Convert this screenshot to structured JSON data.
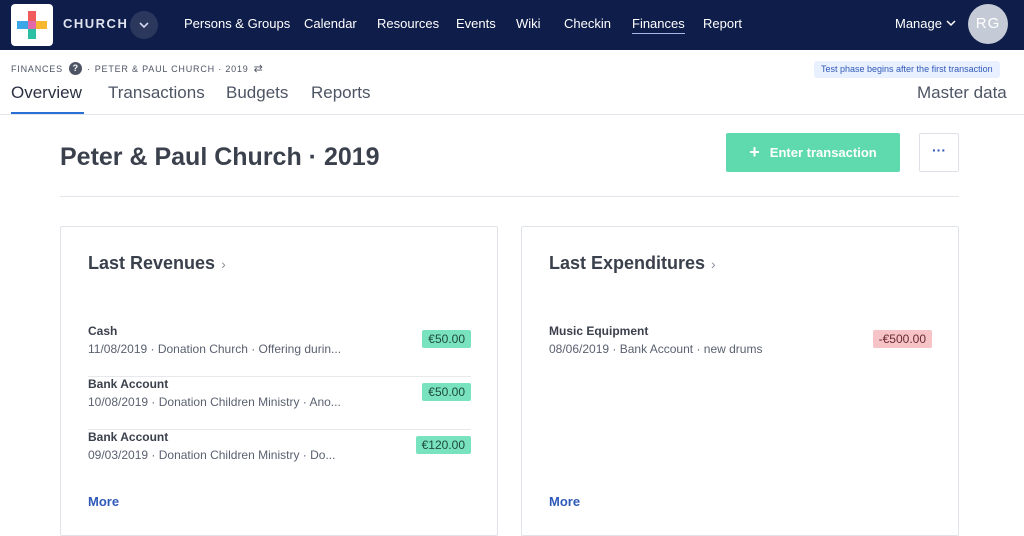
{
  "nav": {
    "logo_name": "church-logo",
    "brand": "CHURCH",
    "items": [
      {
        "label": "Persons & Groups"
      },
      {
        "label": "Calendar"
      },
      {
        "label": "Resources"
      },
      {
        "label": "Events"
      },
      {
        "label": "Wiki"
      },
      {
        "label": "Checkin"
      },
      {
        "label": "Finances",
        "active": true
      },
      {
        "label": "Report"
      }
    ],
    "manage": "Manage",
    "avatar_initials": "RG"
  },
  "subheader": {
    "crumb_section": "FINANCES",
    "crumb_sep": "·",
    "crumb_context": "PETER & PAUL CHURCH · 2019",
    "help_icon": "?",
    "switch_icon": "⇄",
    "test_badge": "Test phase begins after the first transaction",
    "tabs": [
      "Overview",
      "Transactions",
      "Budgets",
      "Reports"
    ],
    "master_data": "Master data"
  },
  "page": {
    "title": "Peter & Paul Church · 2019",
    "enter_button": "Enter transaction",
    "enter_icon": "+",
    "more_icon": "···"
  },
  "revenues": {
    "title": "Last Revenues",
    "chevron": "›",
    "rows": [
      {
        "name": "Cash",
        "desc": "11/08/2019 · Donation Church · Offering durin...",
        "amount": "€50.00"
      },
      {
        "name": "Bank Account",
        "desc": "10/08/2019 · Donation Children Ministry · Ano...",
        "amount": "€50.00"
      },
      {
        "name": "Bank Account",
        "desc": "09/03/2019 · Donation Children Ministry · Do...",
        "amount": "€120.00"
      }
    ],
    "more": "More"
  },
  "expenditures": {
    "title": "Last Expenditures",
    "chevron": "›",
    "rows": [
      {
        "name": "Music Equipment",
        "desc": "08/06/2019 · Bank Account · new drums",
        "amount": "-€500.00"
      }
    ],
    "more": "More"
  },
  "colors": {
    "nav_bg": "#0f1d4a",
    "accent": "#2a6fd6",
    "positive": "#79e3c0",
    "negative": "#f6c3c6",
    "button": "#5fd9ae"
  }
}
